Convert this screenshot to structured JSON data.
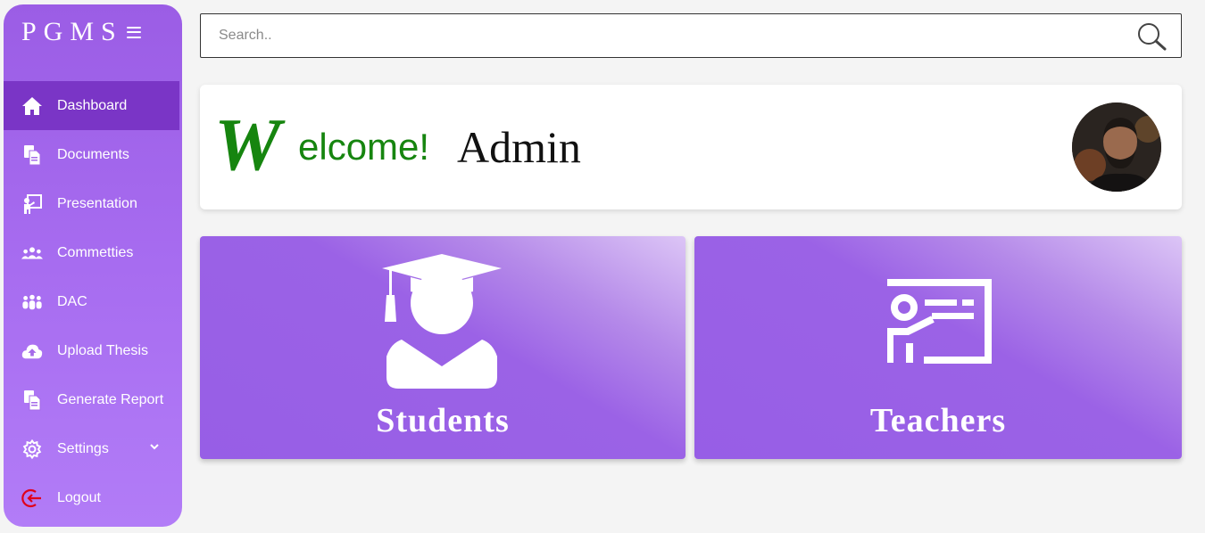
{
  "sidebar": {
    "brand": "PGMS",
    "items": [
      {
        "label": "Dashboard",
        "icon": "home-icon",
        "active": true
      },
      {
        "label": "Documents",
        "icon": "documents-icon"
      },
      {
        "label": "Presentation",
        "icon": "presentation-icon"
      },
      {
        "label": "Commetties",
        "icon": "users-icon"
      },
      {
        "label": "DAC",
        "icon": "group-icon"
      },
      {
        "label": "Upload Thesis",
        "icon": "cloud-upload-icon"
      },
      {
        "label": "Generate Report",
        "icon": "report-icon"
      },
      {
        "label": "Settings",
        "icon": "gear-icon",
        "has_submenu": true
      },
      {
        "label": "Logout",
        "icon": "logout-icon",
        "icon_color": "#e0001b"
      }
    ]
  },
  "search": {
    "placeholder": "Search..",
    "value": ""
  },
  "welcome": {
    "logo_letter": "W",
    "greeting_rest": "elcome!",
    "user_name": "Admin",
    "greeting_color": "#16850f"
  },
  "tiles": [
    {
      "label": "Students",
      "icon": "graduate-icon"
    },
    {
      "label": "Teachers",
      "icon": "teacher-icon"
    }
  ],
  "colors": {
    "sidebar_top": "#9b5de5",
    "sidebar_bottom": "#b27cf7",
    "active_item": "#7a35c6",
    "tile_base": "#975ee6",
    "tile_highlight": "#dcc5f6"
  }
}
